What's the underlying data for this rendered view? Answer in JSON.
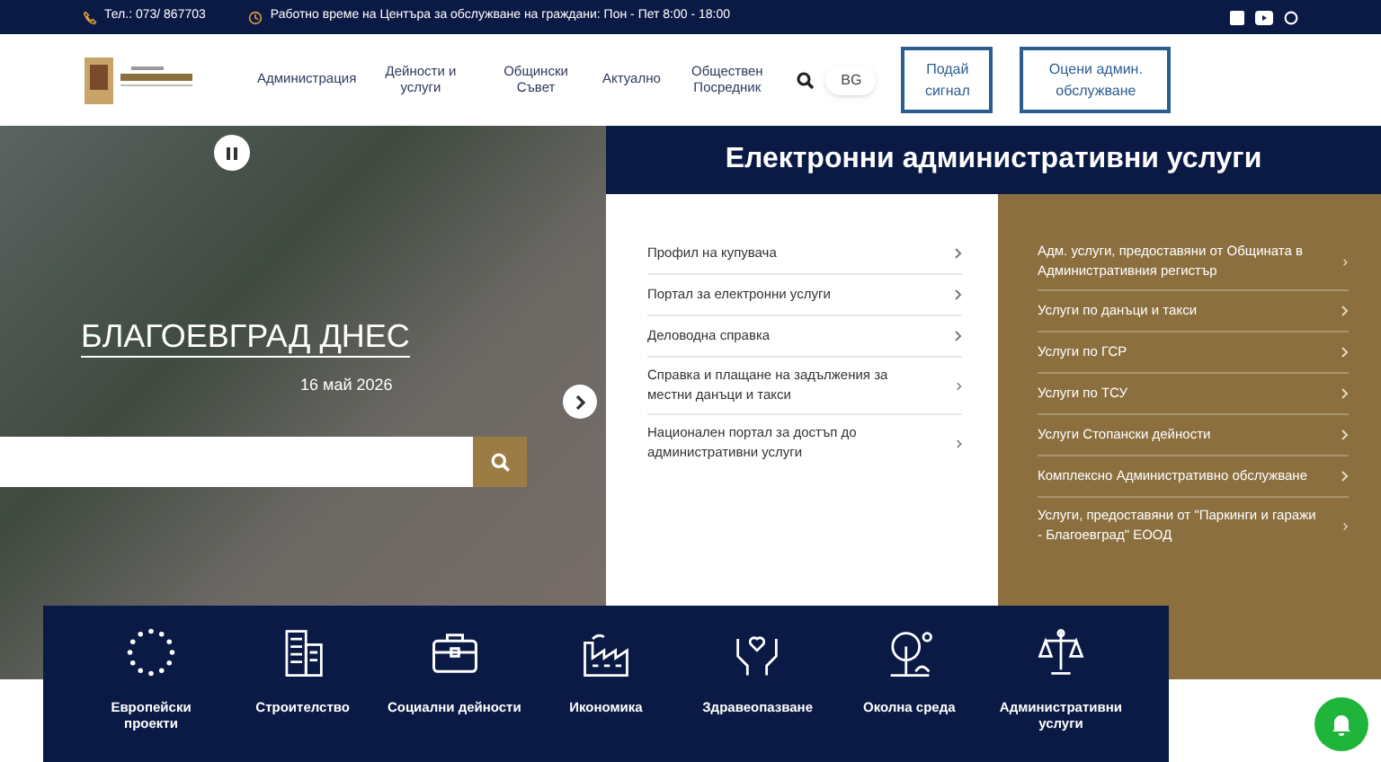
{
  "topbar": {
    "phone": "Тел.: 073/ 867703",
    "hours": "Работно време на Центъра за обслужване на граждани: Пон - Пет 8:00 - 18:00"
  },
  "header": {
    "nav": [
      "Администрация",
      "Дейности и услуги",
      "Общински Съвет",
      "Актуално",
      "Обществен Посредник"
    ],
    "language": "BG",
    "buttons": [
      "Подай сигнал",
      "Оцени админ. обслужване"
    ]
  },
  "hero": {
    "title": "БЛАГОЕВГРАД ДНЕС",
    "date": "16 май 2026"
  },
  "services": {
    "title": "Електронни административни услуги",
    "left": [
      "Профил на купувача",
      "Портал за електронни услуги",
      "Деловодна справка",
      "Справка и плащане на задължения за местни данъци и такси",
      "Национален портал за достъп до административни услуги"
    ],
    "right": [
      "Адм. услуги, предоставяни от Общината в Административния регистър",
      "Услуги по данъци и такси",
      "Услуги по ГСР",
      "Услуги по ТСУ",
      "Услуги Стопански дейности",
      "Комплексно Административно обслужване",
      "Услуги, предоставяни от \"Паркинги и гаражи - Благоевград\" ЕООД"
    ]
  },
  "categories": [
    {
      "label": "Европейски проекти",
      "kind": "stars"
    },
    {
      "label": "Строителство",
      "kind": "building"
    },
    {
      "label": "Социални дейности",
      "kind": "briefcase"
    },
    {
      "label": "Икономика",
      "kind": "factory"
    },
    {
      "label": "Здравеопазване",
      "kind": "hands"
    },
    {
      "label": "Околна среда",
      "kind": "tree"
    },
    {
      "label": "Административни услуги",
      "kind": "scales"
    }
  ]
}
